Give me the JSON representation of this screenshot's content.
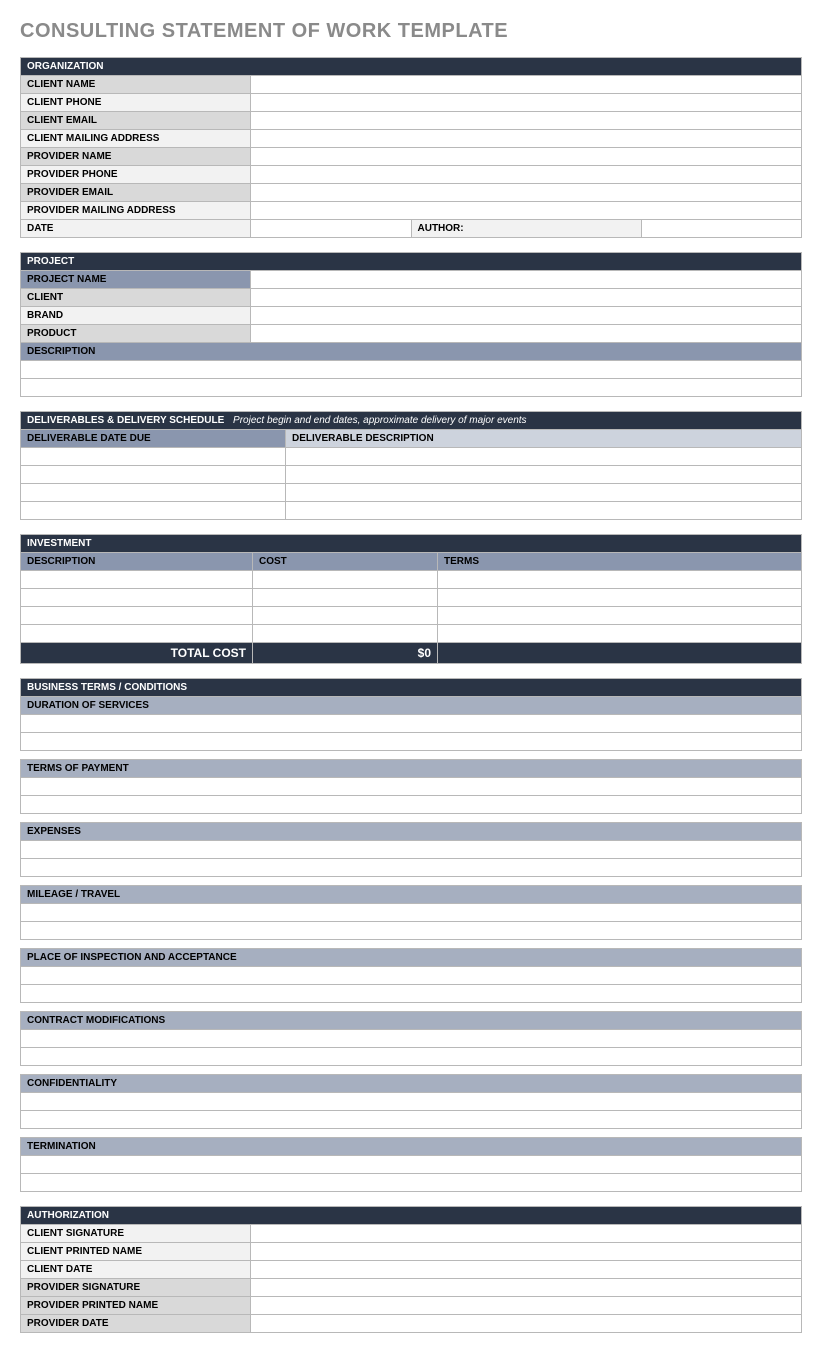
{
  "title": "CONSULTING STATEMENT OF WORK TEMPLATE",
  "org": {
    "header": "ORGANIZATION",
    "client_name": "CLIENT NAME",
    "client_phone": "CLIENT  PHONE",
    "client_email": "CLIENT EMAIL",
    "client_mailing": "CLIENT MAILING ADDRESS",
    "provider_name": "PROVIDER NAME",
    "provider_phone": "PROVIDER PHONE",
    "provider_email": "PROVIDER EMAIL",
    "provider_mailing": "PROVIDER MAILING ADDRESS",
    "date": "DATE",
    "author": "AUTHOR:"
  },
  "project": {
    "header": "PROJECT",
    "name": "PROJECT NAME",
    "client": "CLIENT",
    "brand": "BRAND",
    "product": "PRODUCT",
    "description": "DESCRIPTION"
  },
  "deliverables": {
    "header": "DELIVERABLES & DELIVERY SCHEDULE",
    "note": "Project begin and end dates, approximate delivery of major events",
    "col_date": "DELIVERABLE DATE DUE",
    "col_desc": "DELIVERABLE DESCRIPTION"
  },
  "investment": {
    "header": "INVESTMENT",
    "col_desc": "DESCRIPTION",
    "col_cost": "COST",
    "col_terms": "TERMS",
    "total_label": "TOTAL COST",
    "total_value": "$0"
  },
  "terms": {
    "header": "BUSINESS TERMS / CONDITIONS",
    "duration": "DURATION OF SERVICES",
    "payment": "TERMS OF PAYMENT",
    "expenses": "EXPENSES",
    "mileage": "MILEAGE / TRAVEL",
    "inspection": "PLACE OF INSPECTION AND ACCEPTANCE",
    "modifications": "CONTRACT MODIFICATIONS",
    "confidentiality": "CONFIDENTIALITY",
    "termination": "TERMINATION"
  },
  "auth": {
    "header": "AUTHORIZATION",
    "client_sig": "CLIENT SIGNATURE",
    "client_name": "CLIENT PRINTED NAME",
    "client_date": "CLIENT DATE",
    "provider_sig": "PROVIDER SIGNATURE",
    "provider_name": "PROVIDER PRINTED NAME",
    "provider_date": "PROVIDER DATE"
  }
}
